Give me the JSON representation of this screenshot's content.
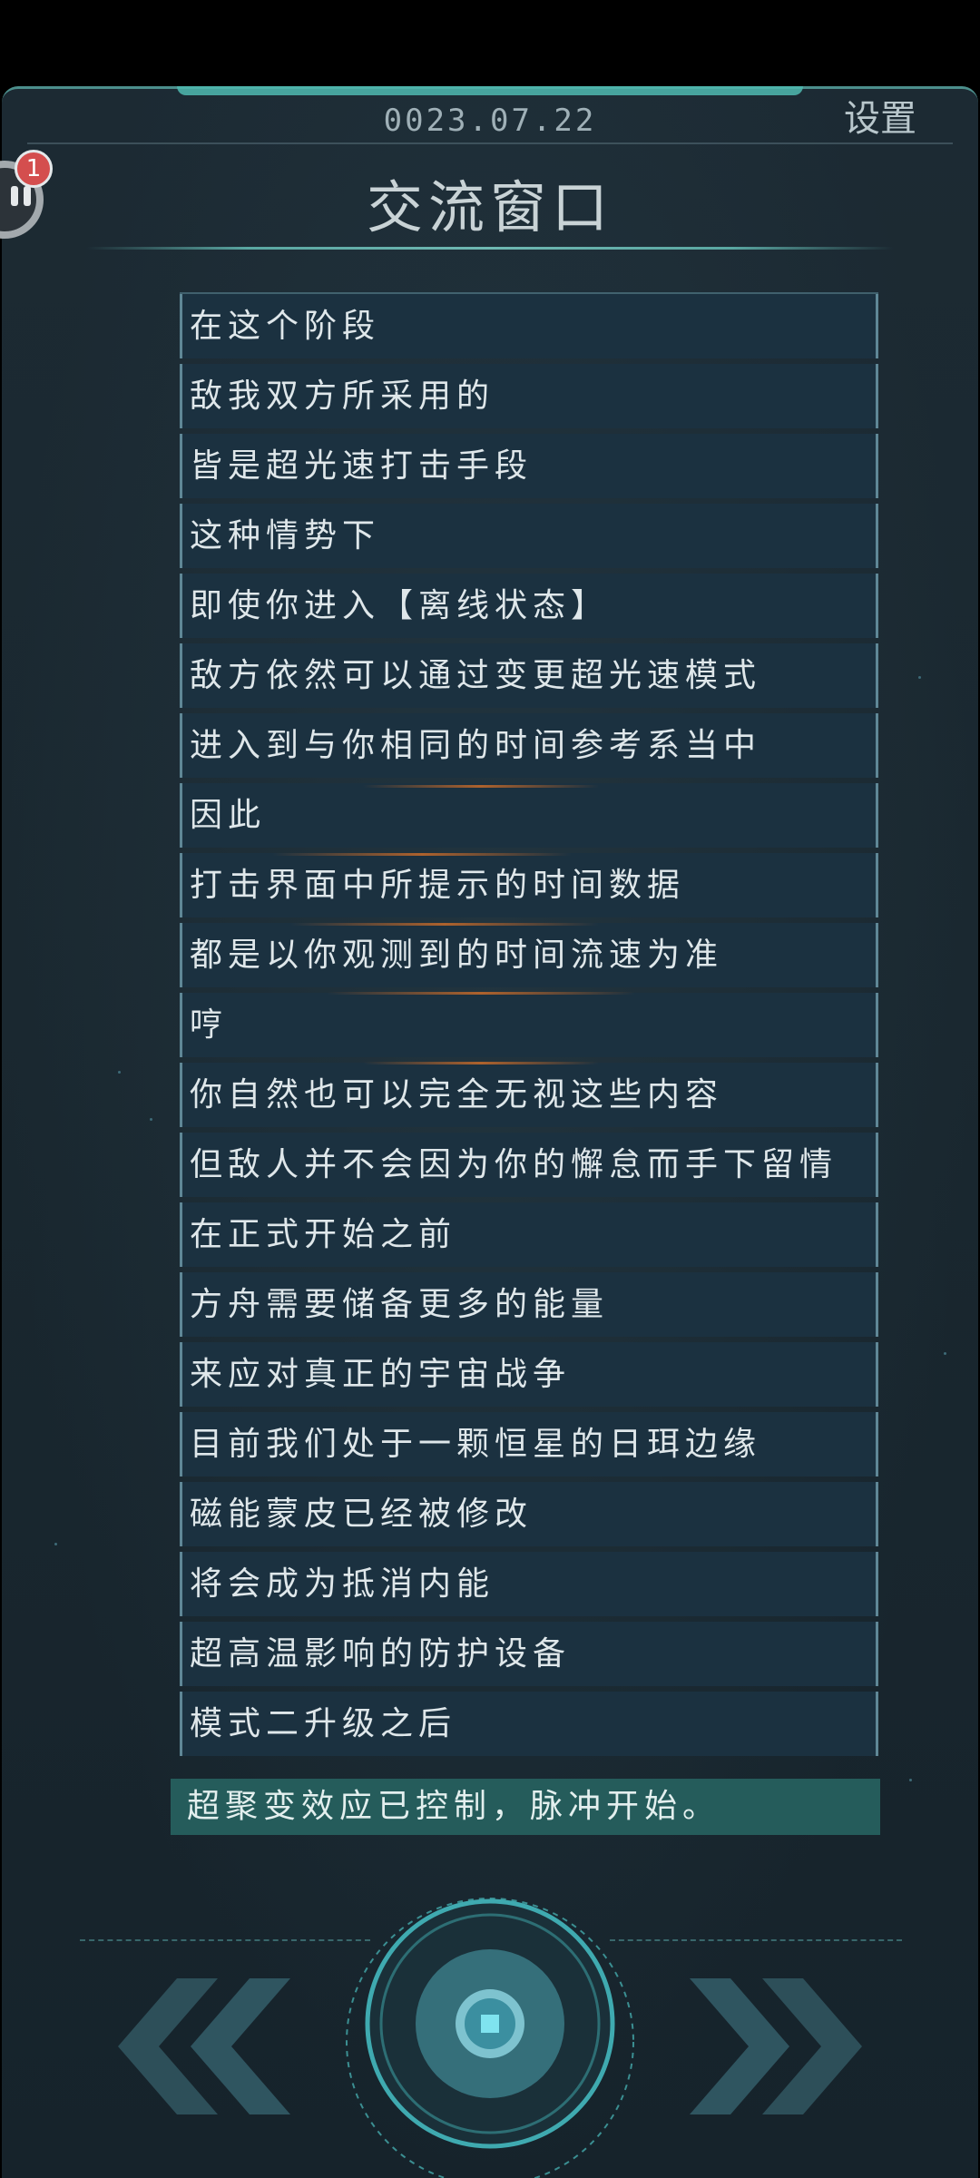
{
  "header": {
    "date": "0023.07.22",
    "settings_label": "设置",
    "title": "交流窗口"
  },
  "avatar": {
    "badge_count": "1",
    "icon": "robot-face-icon"
  },
  "messages": [
    "在这个阶段",
    "敌我双方所采用的",
    "皆是超光速打击手段",
    "这种情势下",
    "即使你进入【离线状态】",
    "敌方依然可以通过变更超光速模式",
    "进入到与你相同的时间参考系当中",
    "因此",
    "打击界面中所提示的时间数据",
    "都是以你观测到的时间流速为准",
    "哼",
    "你自然也可以完全无视这些内容",
    "但敌人并不会因为你的懈怠而手下留情",
    "在正式开始之前",
    "方舟需要储备更多的能量",
    "来应对真正的宇宙战争",
    "目前我们处于一颗恒星的日珥边缘",
    "磁能蒙皮已经被修改",
    "将会成为抵消内能",
    "超高温影响的防护设备",
    "模式二升级之后"
  ],
  "system_message": "超聚变效应已控制，脉冲开始。",
  "controls": {
    "rewind_icon": "double-chevron-left-icon",
    "center_icon": "stop-square-icon",
    "forward_icon": "double-chevron-right-icon"
  },
  "colors": {
    "panel_border": "#4c8f8c",
    "message_bg": "#1b3140",
    "system_bg": "#255c5b",
    "accent_teal": "#5fc9c8",
    "badge_red": "#d44e4e"
  }
}
